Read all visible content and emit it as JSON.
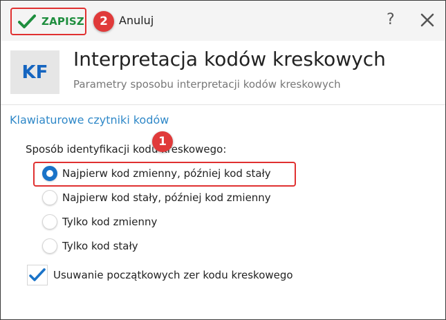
{
  "toolbar": {
    "save_label": "ZAPISZ",
    "cancel_label": "Anuluj",
    "help_label": "?",
    "badge_save": "2"
  },
  "header": {
    "icon_text": "KF",
    "title": "Interpretacja kodów kreskowych",
    "subtitle": "Parametry sposobu interpretacji kodów kreskowych"
  },
  "section": {
    "title": "Klawiaturowe czytniki kodów",
    "question": "Sposób identyfikacji kodu kreskowego:",
    "badge_option": "1",
    "options": [
      {
        "label": "Najpierw kod zmienny, później kod stały",
        "selected": true
      },
      {
        "label": "Najpierw kod stały, później kod zmienny",
        "selected": false
      },
      {
        "label": "Tylko kod zmienny",
        "selected": false
      },
      {
        "label": "Tylko kod stały",
        "selected": false
      }
    ],
    "checkbox": {
      "label": "Usuwanie początkowych zer kodu kreskowego",
      "checked": true
    }
  },
  "colors": {
    "accent": "#1a73c8",
    "save_green": "#1e8e3e",
    "highlight_red": "#e03030",
    "section_blue": "#2f88c8"
  },
  "icons": [
    "checkmark-icon",
    "help-icon",
    "close-icon"
  ]
}
